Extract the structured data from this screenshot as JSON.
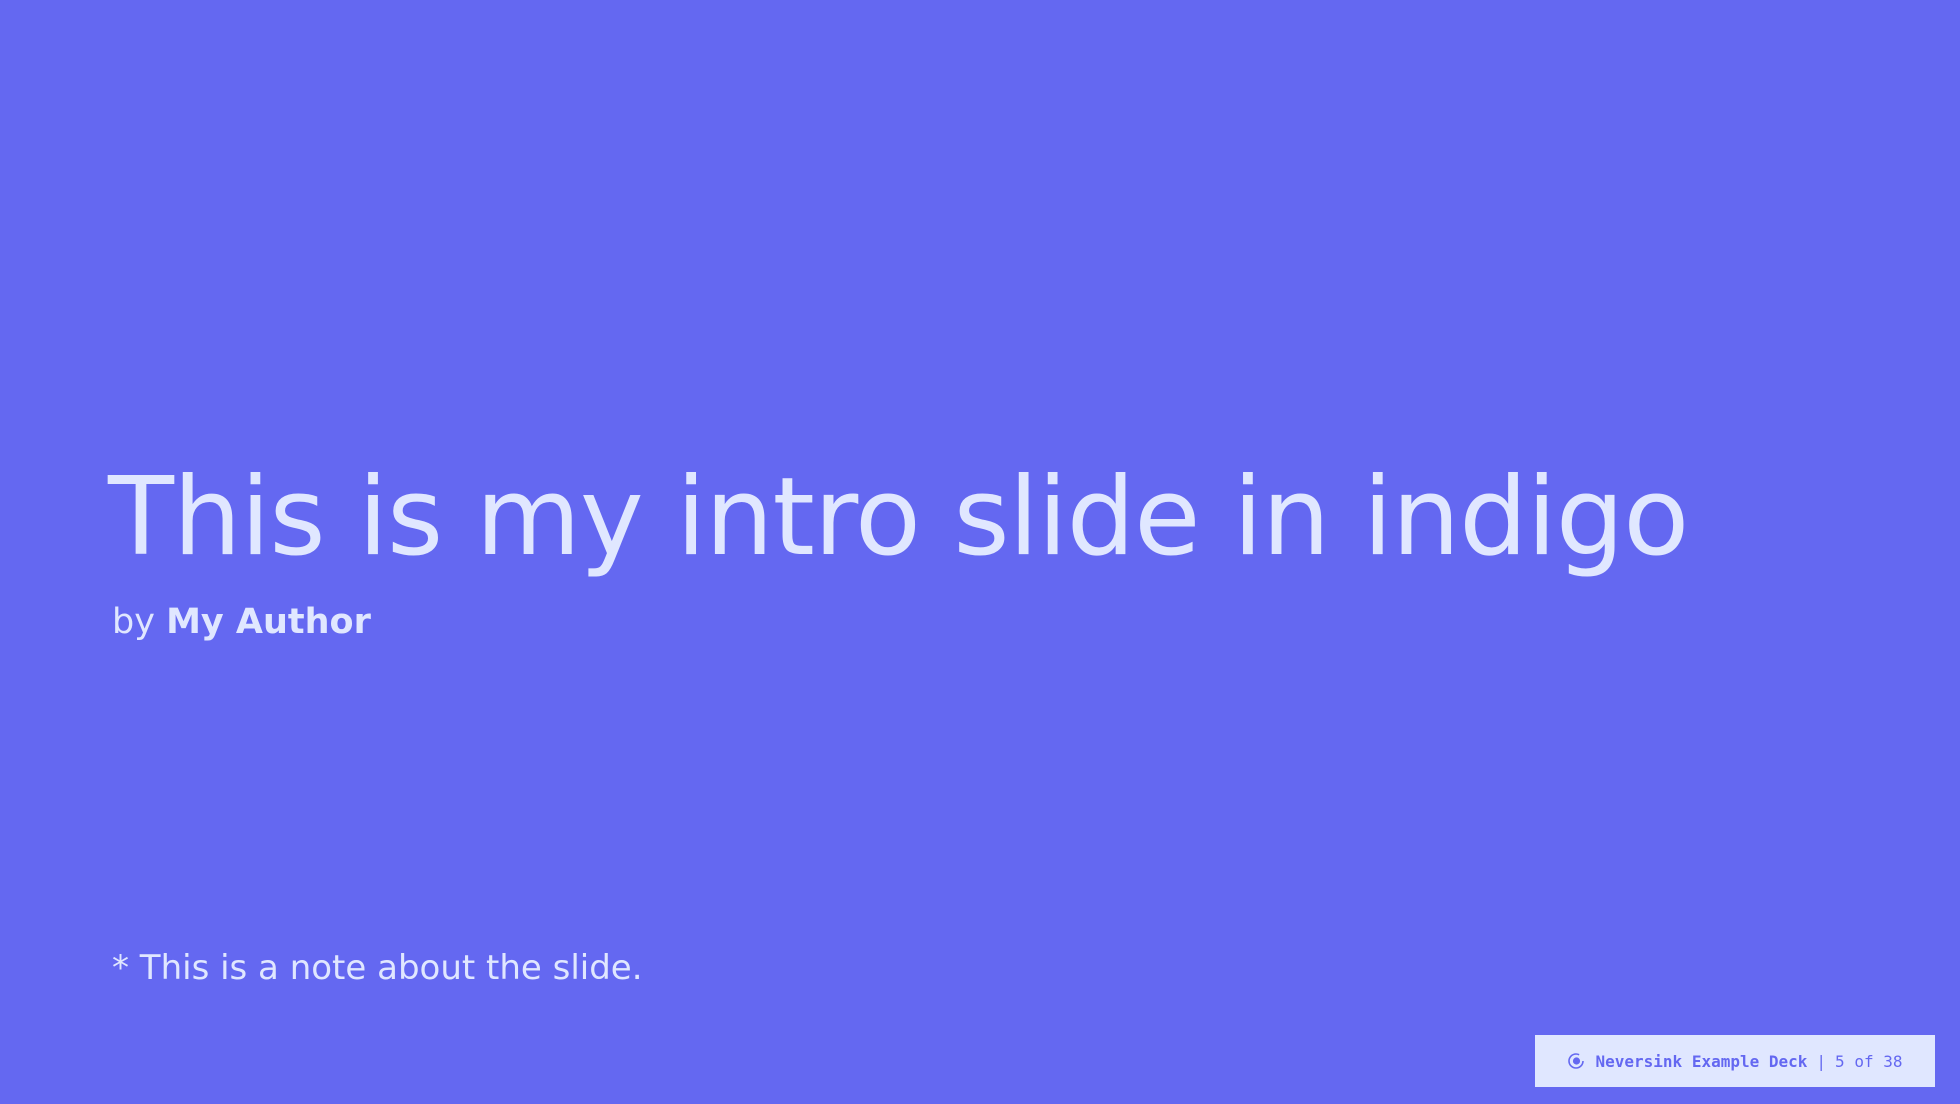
{
  "slide": {
    "title": "This is my intro slide in indigo",
    "byline_prefix": "by",
    "author": "My Author",
    "note": "* This is a note about the slide."
  },
  "footer": {
    "logo_icon": "neversink-logo-icon",
    "deck_name": "Neversink Example Deck",
    "separator": "|",
    "page_current": "5",
    "page_of": "of",
    "page_total": "38"
  },
  "colors": {
    "background": "#6468f1",
    "text": "#e0e7ff",
    "footer_bg": "#e0e7ff",
    "footer_text": "#6468f1"
  }
}
